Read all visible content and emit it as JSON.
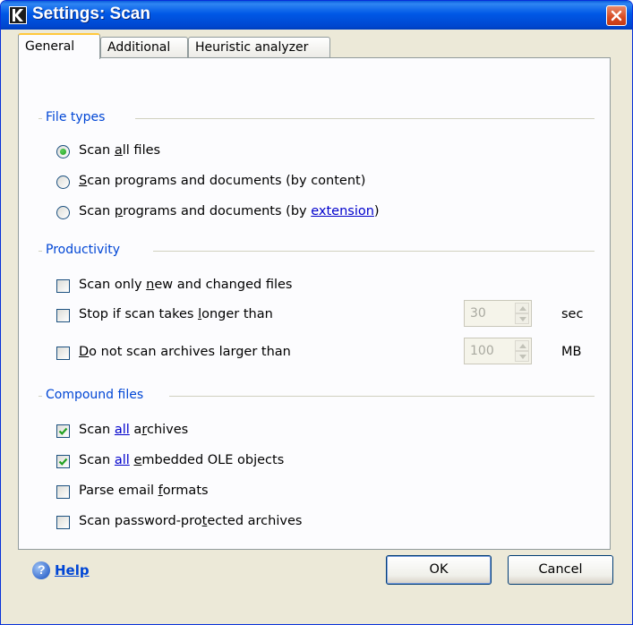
{
  "window": {
    "title": "Settings: Scan"
  },
  "tabs": [
    {
      "label": "General",
      "active": true
    },
    {
      "label": "Additional",
      "active": false
    },
    {
      "label": "Heuristic analyzer",
      "active": false
    }
  ],
  "file_types": {
    "title": "File types",
    "options": [
      {
        "pre": "Scan ",
        "u": "a",
        "post": "ll files",
        "selected": true
      },
      {
        "pre": "",
        "u": "S",
        "post": "can programs and documents (by content)",
        "selected": false
      },
      {
        "pre": "Scan ",
        "u": "p",
        "post": "rograms and documents (by ",
        "link": "extension",
        "tail": ")",
        "selected": false
      }
    ]
  },
  "productivity": {
    "title": "Productivity",
    "new_changed": {
      "pre": "Scan only ",
      "u": "n",
      "post": "ew and changed files",
      "checked": false
    },
    "stop_longer": {
      "pre": "Stop if scan takes ",
      "u": "l",
      "post": "onger than",
      "checked": false,
      "value": "30",
      "unit": "sec"
    },
    "archives_larger": {
      "pre": "",
      "u": "D",
      "post": "o not scan archives larger than",
      "checked": false,
      "value": "100",
      "unit": "MB"
    }
  },
  "compound": {
    "title": "Compound files",
    "all_archives": {
      "pre": "Scan ",
      "link": "all",
      "mid": " a",
      "u": "r",
      "post": "chives",
      "checked": true
    },
    "ole": {
      "pre": "Scan ",
      "link": "all",
      "mid": " ",
      "u": "e",
      "post": "mbedded OLE objects",
      "checked": true
    },
    "email": {
      "pre": "Parse email ",
      "u": "f",
      "post": "ormats",
      "checked": false
    },
    "password": {
      "pre": "Scan password-pro",
      "u": "t",
      "post": "ected archives",
      "checked": false
    }
  },
  "footer": {
    "help": "Help",
    "ok": "OK",
    "cancel": "Cancel"
  }
}
